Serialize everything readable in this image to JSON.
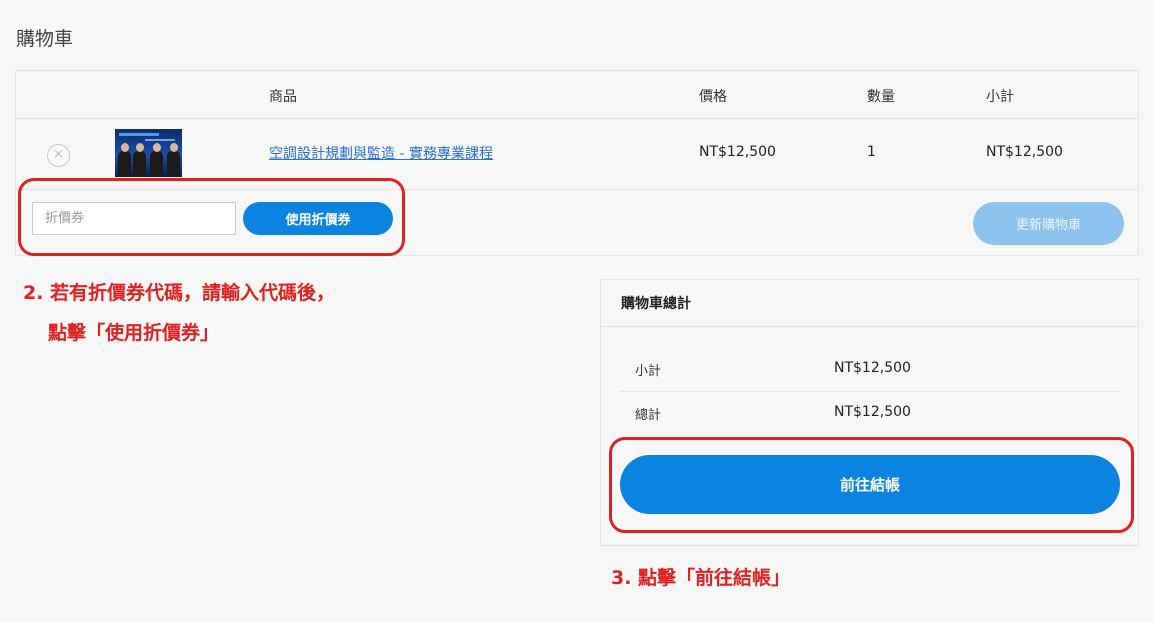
{
  "page": {
    "title": "購物車"
  },
  "cart": {
    "headers": {
      "product": "商品",
      "price": "價格",
      "quantity": "數量",
      "subtotal": "小計"
    },
    "items": [
      {
        "remove_icon": "×",
        "thumbnail": "course-thumbnail-four-presenters",
        "name": "空調設計規劃與監造 - 實務專業課程",
        "price": "NT$12,500",
        "quantity": "1",
        "subtotal": "NT$12,500"
      }
    ],
    "coupon": {
      "placeholder": "折價券",
      "value": "",
      "apply_label": "使用折價券"
    },
    "update_label": "更新購物車"
  },
  "totals": {
    "heading": "購物車總計",
    "rows": [
      {
        "label": "小計",
        "value": "NT$12,500"
      },
      {
        "label": "總計",
        "value": "NT$12,500"
      }
    ],
    "checkout_label": "前往結帳"
  },
  "annotations": {
    "step2_line1": "2. 若有折價券代碼，請輸入代碼後，",
    "step2_line2": "點擊「使用折價券」",
    "step3": "3. 點擊「前往結帳」",
    "color": "#e02121"
  },
  "colors": {
    "primary": "#0a84e0",
    "primary_disabled": "#8cc3ef",
    "link": "#2a6fd6"
  }
}
